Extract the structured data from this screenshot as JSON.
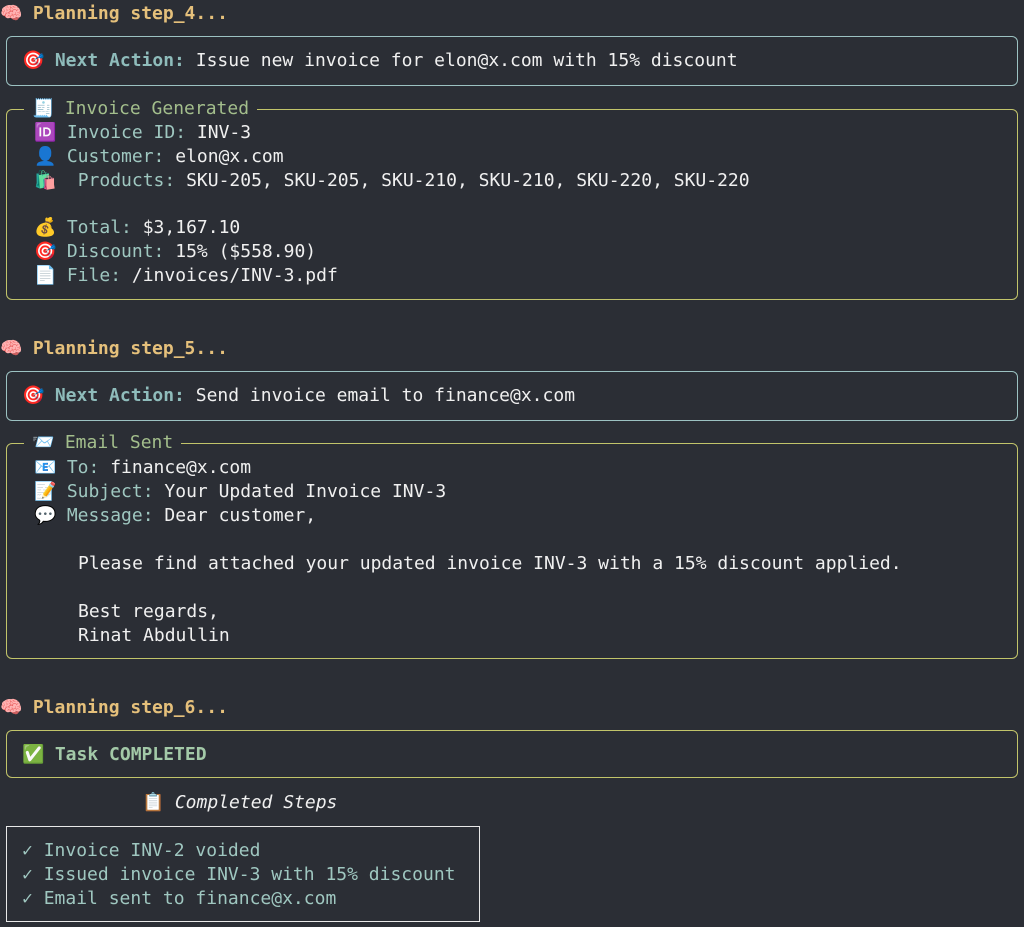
{
  "steps": [
    {
      "label": "Planning step_4..."
    },
    {
      "label": "Planning step_5..."
    },
    {
      "label": "Planning step_6..."
    }
  ],
  "action1": {
    "label": "Next Action:",
    "text": "Issue new invoice for elon@x.com with 15% discount"
  },
  "invoice": {
    "title": "Invoice Generated",
    "id_label": "Invoice ID:",
    "id_value": "INV-3",
    "customer_label": "Customer:",
    "customer_value": "elon@x.com",
    "products_label": "Products:",
    "products_value": "SKU-205, SKU-205, SKU-210, SKU-210, SKU-220, SKU-220",
    "total_label": "Total:",
    "total_value": "$3,167.10",
    "discount_label": "Discount:",
    "discount_value": "15% ($558.90)",
    "file_label": "File:",
    "file_value": "/invoices/INV-3.pdf"
  },
  "action2": {
    "label": "Next Action:",
    "text": "Send invoice email to finance@x.com"
  },
  "email": {
    "title": "Email Sent",
    "to_label": "To:",
    "to_value": "finance@x.com",
    "subject_label": "Subject:",
    "subject_value": "Your Updated Invoice INV-3",
    "message_label": "Message:",
    "message_line1": "Dear customer,",
    "message_line2": "Please find attached your updated invoice INV-3 with a 15% discount applied.",
    "message_line3": "Best regards,",
    "message_line4": "Rinat Abdullin"
  },
  "task": {
    "text": "Task COMPLETED"
  },
  "completed": {
    "title": "Completed Steps",
    "items": [
      "Invoice INV-2 voided",
      "Issued invoice INV-3 with 15% discount",
      "Email sent to finance@x.com"
    ]
  },
  "icons": {
    "planning": "brain-icon",
    "action": "target-icon",
    "invoice": "receipt-icon",
    "id": "id-icon",
    "customer": "person-icon",
    "products": "shopping-bag-icon",
    "total": "money-bag-icon",
    "discount": "target-icon",
    "file": "document-icon",
    "email": "envelope-icon",
    "to": "mail-icon",
    "subject": "memo-icon",
    "message": "speech-bubble-icon",
    "task": "check-mark-icon",
    "completed": "clipboard-icon"
  }
}
